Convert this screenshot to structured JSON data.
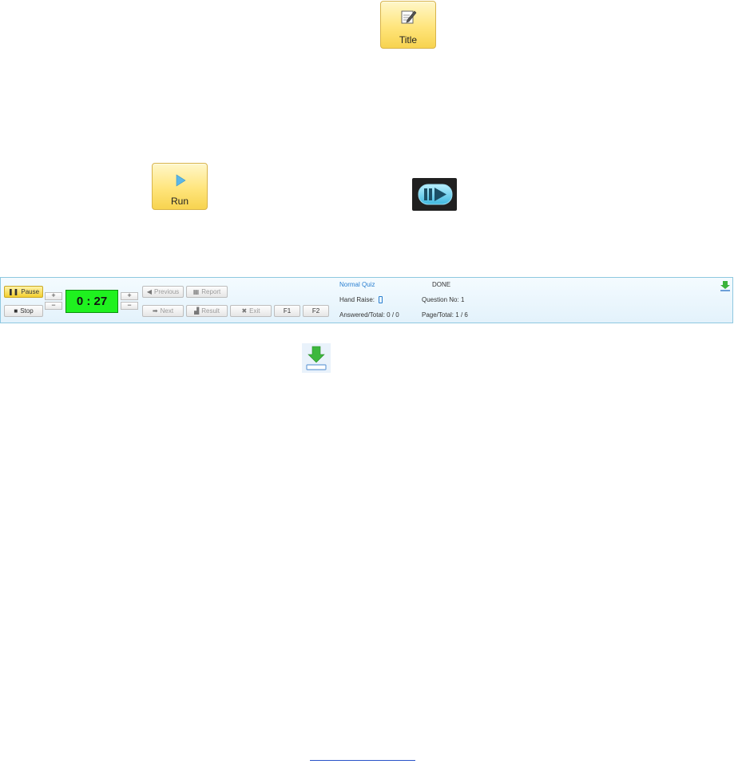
{
  "tiles": {
    "title_label": "Title",
    "run_label": "Run"
  },
  "toolbar": {
    "pause_label": "Pause",
    "stop_label": "Stop",
    "plus_label": "+",
    "minus_label": "−",
    "timer_value": "0 : 27",
    "previous_label": "Previous",
    "report_label": "Report",
    "next_label": "Next",
    "result_label": "Result",
    "exit_label": "Exit",
    "f1_label": "F1",
    "f2_label": "F2"
  },
  "status": {
    "mode": "Normal Quiz",
    "state": "DONE",
    "hand_raise_label": "Hand Raise:",
    "question_no_label": "Question No:",
    "question_no_value": "1",
    "answered_total_label": "Answered/Total:",
    "answered_total_value": "0 / 0",
    "page_total_label": "Page/Total:",
    "page_total_value": "1 / 6"
  },
  "icons": {
    "title_tile": "edit-icon",
    "run_tile": "play-icon",
    "player": "play-pause-icon",
    "download": "download-icon"
  },
  "colors": {
    "timer_bg": "#1ff11f",
    "tile_yellow": "#ffe57c",
    "toolbar_border": "#8fc8e0",
    "accent_blue": "#2a7fd0"
  }
}
